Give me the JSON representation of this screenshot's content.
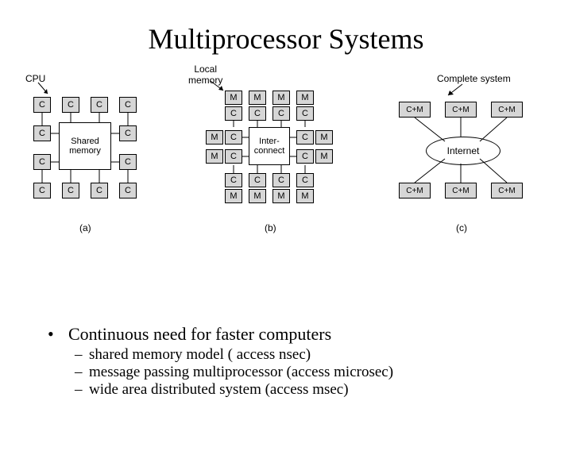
{
  "title": "Multiprocessor Systems",
  "figA": {
    "cpuLabel": "CPU",
    "c": "C",
    "shared": "Shared\nmemory",
    "sub": "(a)"
  },
  "figB": {
    "localLabel": "Local\nmemory",
    "m": "M",
    "c": "C",
    "inter": "Inter-\nconnect",
    "sub": "(b)"
  },
  "figC": {
    "completeLabel": "Complete system",
    "cm": "C+M",
    "internet": "Internet",
    "sub": "(c)"
  },
  "bullet": "Continuous need for faster computers",
  "sub1": "shared memory model ( access nsec)",
  "sub2": "message passing multiprocessor (access microsec)",
  "sub3": "wide area distributed system (access msec)"
}
